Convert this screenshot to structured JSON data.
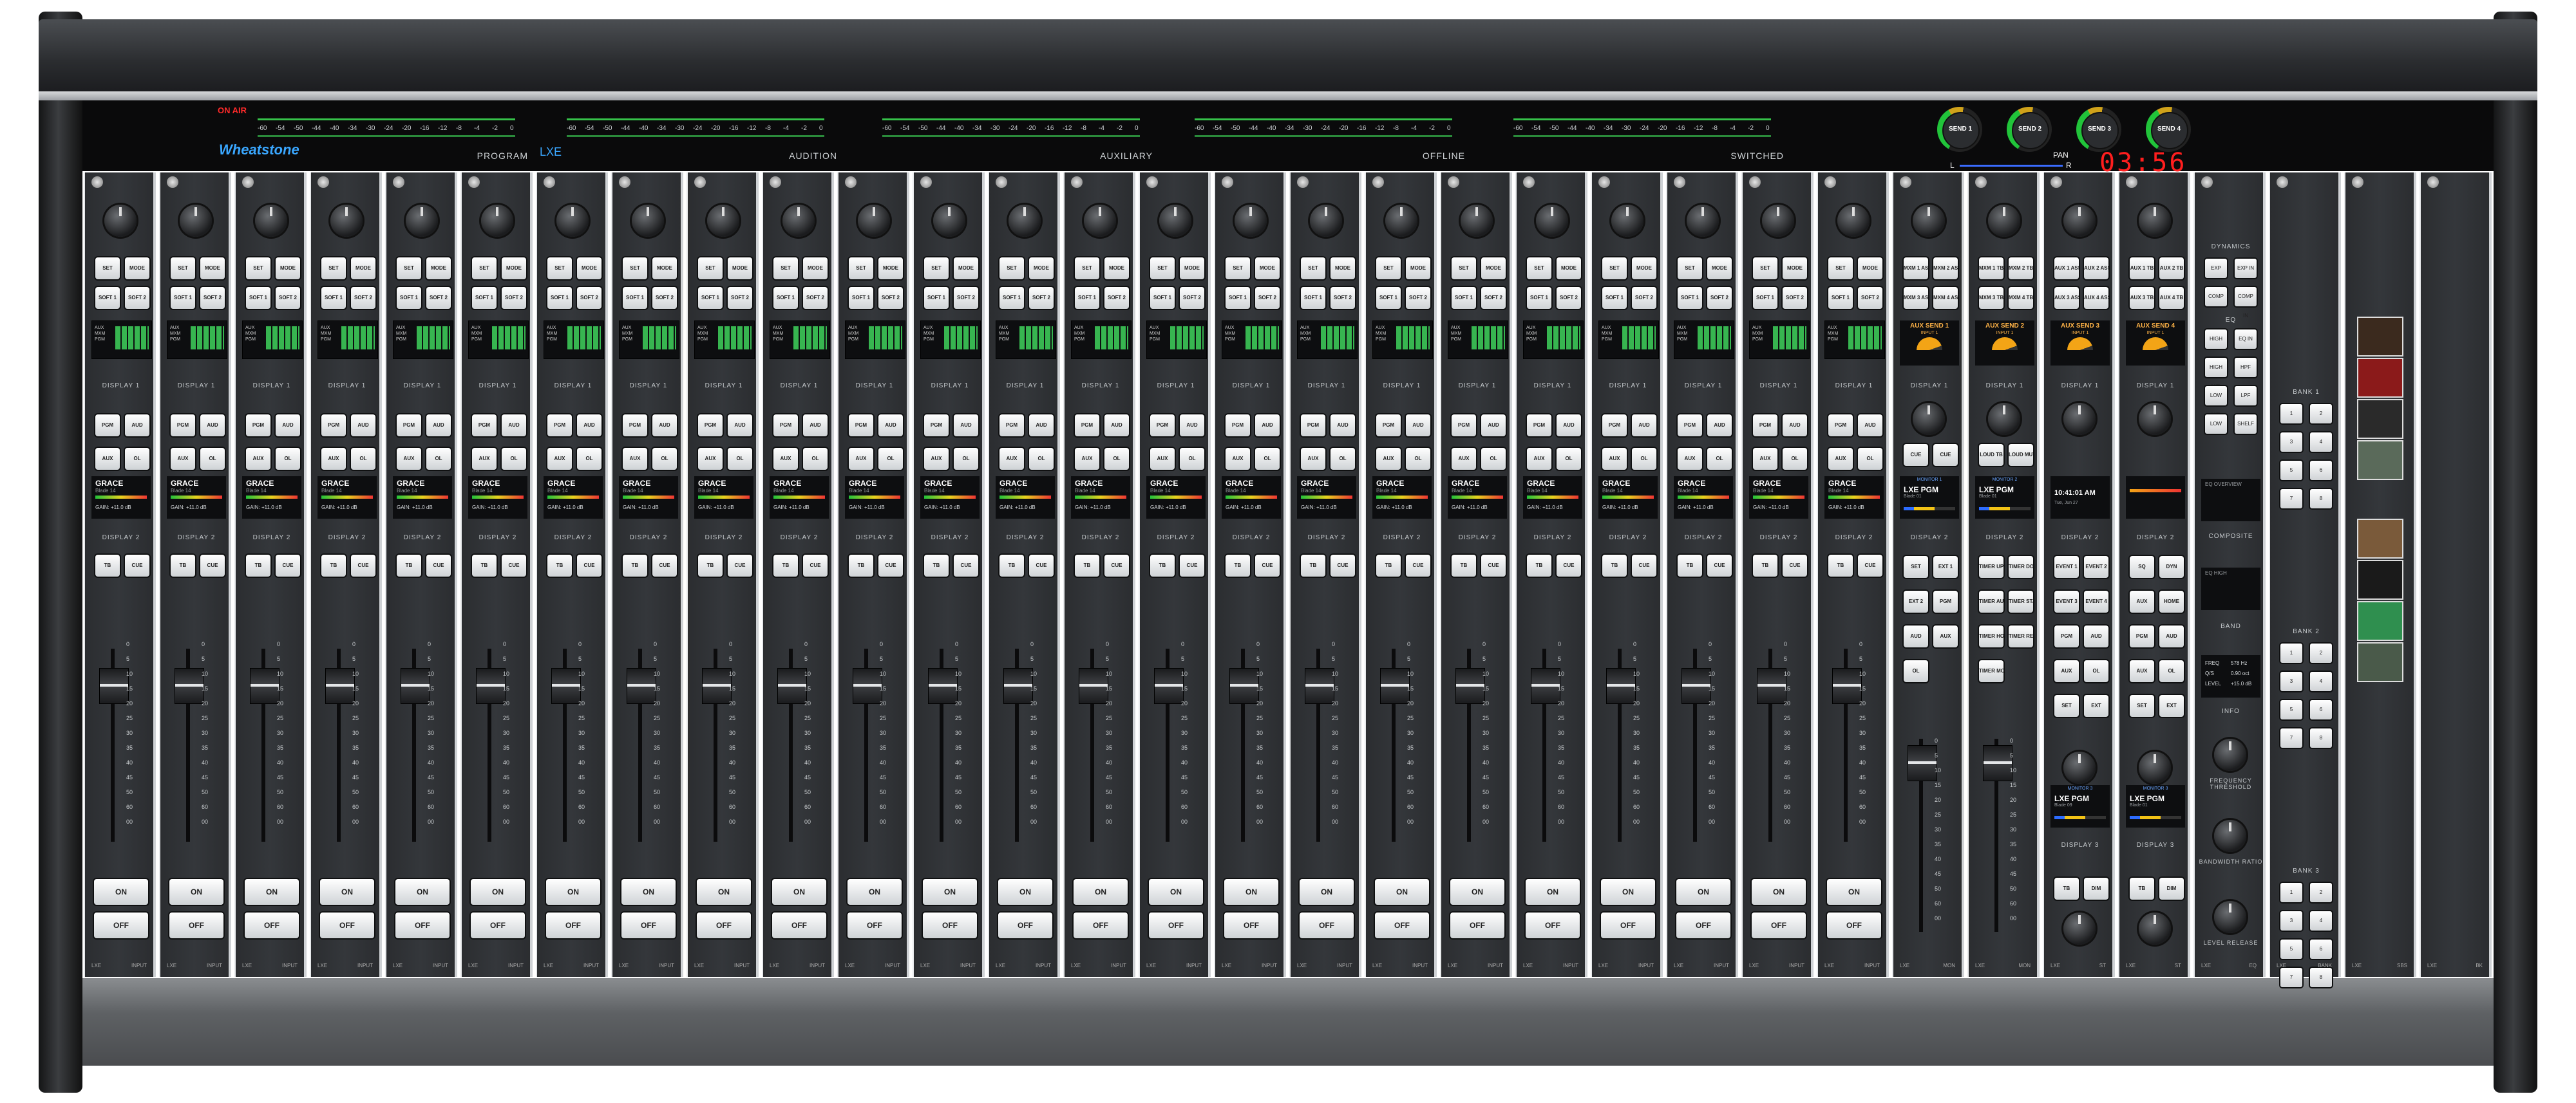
{
  "meters": [
    {
      "name": "PROGRAM",
      "scale": [
        "-60",
        "-54",
        "-50",
        "-44",
        "-40",
        "-34",
        "-30",
        "-24",
        "-20",
        "-16",
        "-12",
        "-8",
        "-4",
        "-2",
        "0"
      ]
    },
    {
      "name": "AUDITION",
      "scale": [
        "-60",
        "-54",
        "-50",
        "-44",
        "-40",
        "-34",
        "-30",
        "-24",
        "-20",
        "-16",
        "-12",
        "-8",
        "-4",
        "-2",
        "0"
      ]
    },
    {
      "name": "AUXILIARY",
      "scale": [
        "-60",
        "-54",
        "-50",
        "-44",
        "-40",
        "-34",
        "-30",
        "-24",
        "-20",
        "-16",
        "-12",
        "-8",
        "-4",
        "-2",
        "0"
      ]
    },
    {
      "name": "OFFLINE",
      "scale": [
        "-60",
        "-54",
        "-50",
        "-44",
        "-40",
        "-34",
        "-30",
        "-24",
        "-20",
        "-16",
        "-12",
        "-8",
        "-4",
        "-2",
        "0"
      ]
    },
    {
      "name": "SWITCHED",
      "scale": [
        "-60",
        "-54",
        "-50",
        "-44",
        "-40",
        "-34",
        "-30",
        "-24",
        "-20",
        "-16",
        "-12",
        "-8",
        "-4",
        "-2",
        "0"
      ]
    }
  ],
  "bridge": {
    "on_air": "ON AIR",
    "brand": "Wheatstone",
    "lxe": "LXE",
    "pan": "PAN",
    "pan_l": "L",
    "pan_r": "R",
    "clock": "03:56"
  },
  "sends": [
    "SEND 1",
    "SEND 2",
    "SEND 3",
    "SEND 4"
  ],
  "input_strip": {
    "buttons_top": [
      "SET",
      "MODE",
      "SOFT 1",
      "SOFT 2"
    ],
    "display1_rows": [
      "AUX",
      "MXM",
      "PGM"
    ],
    "display1_label": "DISPLAY 1",
    "buttons_mid": [
      "PGM",
      "AUD",
      "AUX",
      "OL"
    ],
    "display2": {
      "name": "GRACE",
      "sub": "Blade 14",
      "gain": "GAIN: +11.0 dB"
    },
    "display2_label": "DISPLAY 2",
    "buttons_low": [
      "TB",
      "CUE"
    ],
    "fader_scale": [
      "0",
      "5",
      "10",
      "15",
      "20",
      "25",
      "30",
      "35",
      "40",
      "45",
      "50",
      "60",
      "00"
    ],
    "on": "ON",
    "off": "OFF",
    "mode": [
      "LXE",
      "INPUT"
    ]
  },
  "input_strip_count": 24,
  "monitor_strips": [
    {
      "send": "AUX SEND 1",
      "input": "INPUT 1",
      "buttons": [
        "MXM 1 ASSIGN",
        "MXM 2 ASSIGN",
        "MXM 3 ASSIGN",
        "MXM 4 ASSIGN"
      ],
      "mon_header": "MONITOR 1",
      "mon_name": "LXE PGM",
      "mon_sub": "Blade 01",
      "mode": [
        "LXE",
        "MON"
      ],
      "extra": [
        "CUE",
        "CUE",
        "SET",
        "EXT 1",
        "EXT 2",
        "PGM",
        "AUD",
        "AUX",
        "OL"
      ]
    },
    {
      "send": "AUX SEND 2",
      "input": "INPUT 1",
      "buttons": [
        "MXM 1 TB",
        "MXM 2 TB",
        "MXM 3 TB",
        "MXM 4 TB"
      ],
      "mon_header": "MONITOR 2",
      "mon_name": "LXE PGM",
      "mon_sub": "Blade 01",
      "mode": [
        "LXE",
        "MON"
      ],
      "extra": [
        "LOUD TB",
        "LOUD MUTE",
        "TIMER UP",
        "TIMER DOWN",
        "TIMER AUTO",
        "TIMER START",
        "TIMER HOLD",
        "TIMER RESET",
        "TIMER MODE"
      ]
    }
  ],
  "st_strips": [
    {
      "send": "AUX SEND 3",
      "input": "INPUT 1",
      "buttons": [
        "AUX 1 ASSIGN",
        "AUX 2 ASSIGN",
        "AUX 3 ASSIGN",
        "AUX 4 ASSIGN"
      ],
      "time": "10:41:01 AM",
      "date": "Tue, Jun 27",
      "mode": [
        "LXE",
        "ST"
      ],
      "extra": [
        "EVENT 1",
        "EVENT 2",
        "EVENT 3",
        "EVENT 4",
        "PGM",
        "AUD",
        "AUX",
        "OL",
        "SET",
        "EXT"
      ],
      "mon_header": "MONITOR 3",
      "mon_name": "LXE PGM",
      "mon_sub": "Blade 09",
      "tb": "TB",
      "dim": "DIM"
    },
    {
      "send": "AUX SEND 4",
      "input": "INPUT 1",
      "buttons": [
        "AUX 1 TB",
        "AUX 2 TB",
        "AUX 3 TB",
        "AUX 4 TB"
      ],
      "mode": [
        "LXE",
        "ST"
      ],
      "extra": [
        "SQ",
        "DYN",
        "AUX",
        "HOME",
        "PGM",
        "AUD",
        "AUX",
        "OL",
        "SET",
        "EXT"
      ],
      "mon_header": "MONITOR 3",
      "mon_name": "LXE PGM",
      "mon_sub": "Blade 01",
      "tb": "TB",
      "dim": "DIM"
    }
  ],
  "eq_strip": {
    "dynamics": "DYNAMICS",
    "eq": "EQ",
    "eq_overview": "EQ OVERVIEW",
    "composite": "COMPOSITE",
    "eq_high": "EQ HIGH",
    "band": "BAND",
    "info": "INFO",
    "buttons": [
      "EXP",
      "EXP IN",
      "COMP",
      "COMP IN",
      "HIGH",
      "EQ IN",
      "HIGH MID",
      "HPF",
      "LOW MID",
      "LPF",
      "LOW",
      "SHELF"
    ],
    "info_rows": [
      [
        "FREQ",
        "578 Hz"
      ],
      [
        "Q/S",
        "0.90 oct"
      ],
      [
        "LEVEL",
        "+15.0 dB"
      ]
    ],
    "knobs": [
      "FREQUENCY THRESHOLD",
      "BANDWIDTH RATIO",
      "LEVEL RELEASE"
    ],
    "mode": [
      "LXE",
      "EQ"
    ]
  },
  "bank_strip": {
    "banks": [
      "BANK 1",
      "BANK 2",
      "BANK 3"
    ],
    "keys": [
      "1",
      "2",
      "3",
      "4",
      "5",
      "6",
      "7",
      "8",
      "9",
      "10",
      "11",
      "12"
    ],
    "mode": [
      "LXE",
      "BANK"
    ]
  },
  "key_strip": {
    "mode": [
      "LXE",
      "SBS"
    ]
  },
  "end_strip": {
    "mode": [
      "LXE",
      "BK"
    ]
  }
}
